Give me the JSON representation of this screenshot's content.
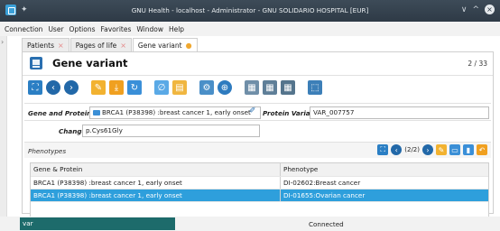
{
  "window": {
    "title": "GNU Health - localhost - Administrator - GNU SOLIDARIO HOSPITAL [EUR]",
    "pin_glyph": "✦",
    "minimize_glyph": "∨",
    "maximize_glyph": "^",
    "close_glyph": "×"
  },
  "menu": [
    "Connection",
    "User",
    "Options",
    "Favorites",
    "Window",
    "Help"
  ],
  "tabs": [
    {
      "label": "Patients",
      "active": false
    },
    {
      "label": "Pages of life",
      "active": false
    },
    {
      "label": "Gene variant",
      "active": true
    }
  ],
  "view": {
    "title": "Gene variant",
    "page_count": "2 / 33"
  },
  "form": {
    "gene_protein_label": "Gene and Protein:",
    "gene_protein_value": "BRCA1 (P38398) :breast cancer 1, early onset",
    "protein_variant_label": "Protein Variant:",
    "protein_variant_value": "VAR_007757",
    "change_label": "Change:",
    "change_value": "p.Cys61Gly"
  },
  "phenotypes": {
    "label": "Phenotypes",
    "record_count": "(2/2)",
    "columns": [
      "Gene & Protein",
      "Phenotype"
    ],
    "rows": [
      {
        "gene_protein": "BRCA1 (P38398) :breast cancer 1, early onset",
        "phenotype": "DI-02602:Breast cancer",
        "selected": false
      },
      {
        "gene_protein": "BRCA1 (P38398) :breast cancer 1, early onset",
        "phenotype": "DI-01655:Ovarian cancer",
        "selected": true
      }
    ]
  },
  "status": {
    "search_value": "var",
    "connection": "Connected"
  },
  "colors": {
    "accent": "#2e9fdc",
    "titlebar": "#333f4b",
    "status_search": "#1d6b6b"
  }
}
